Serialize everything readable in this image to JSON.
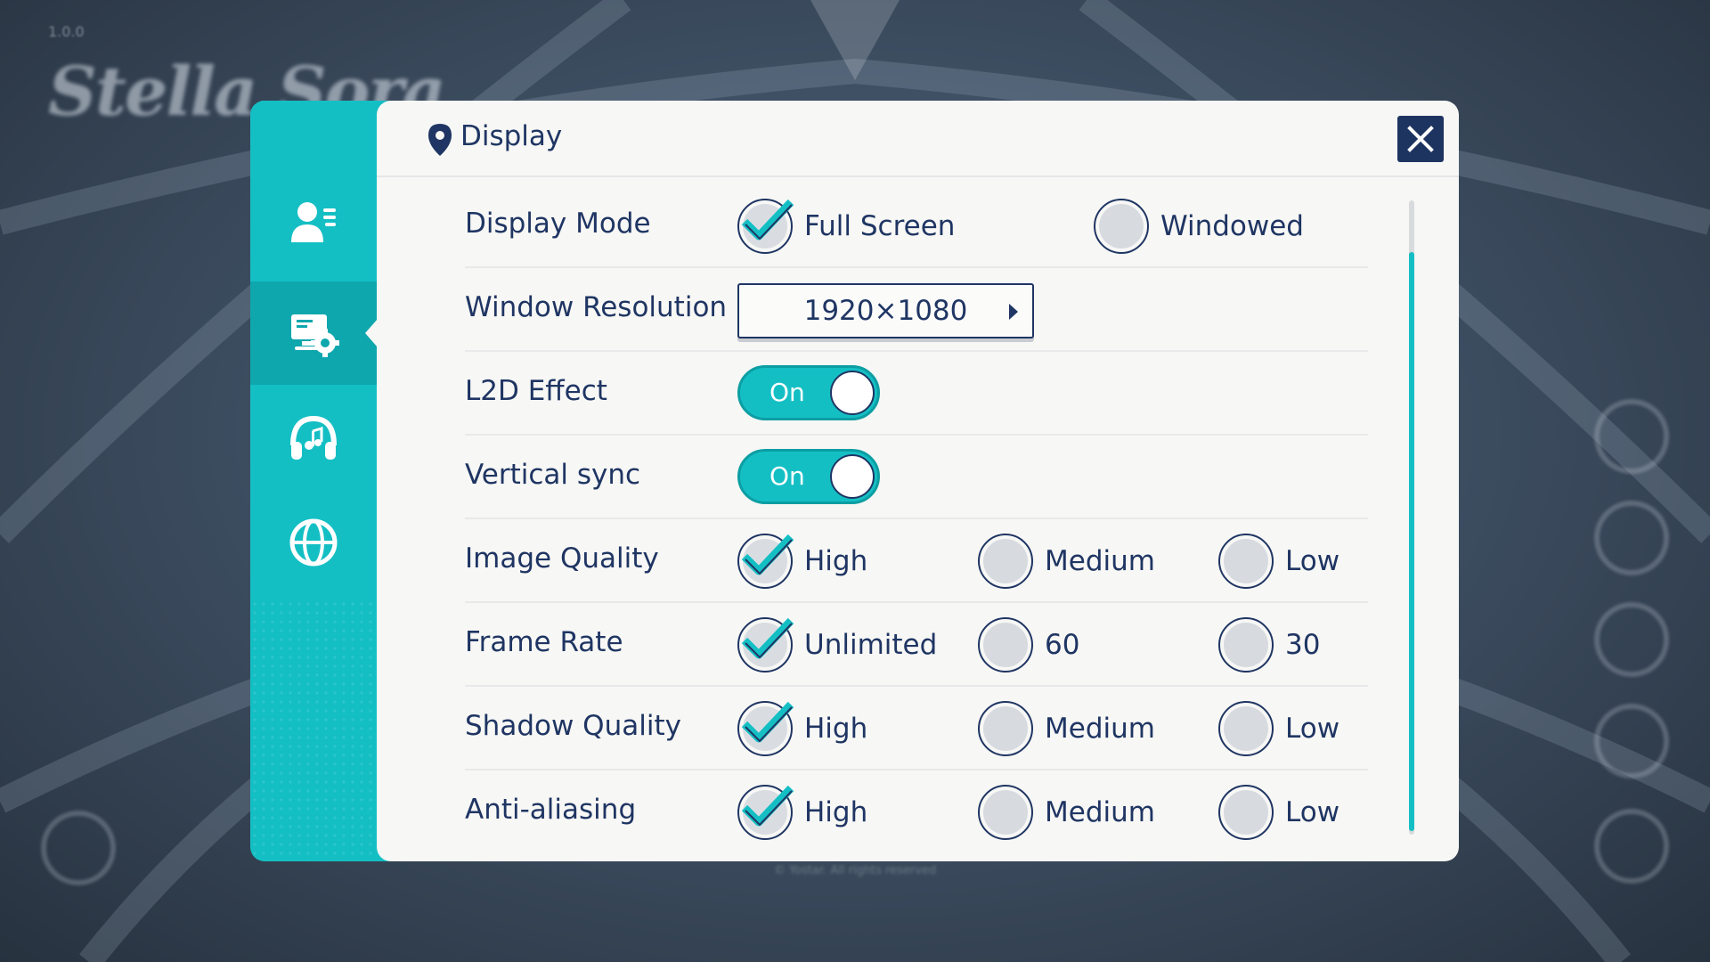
{
  "background": {
    "logo_small": "1.0.0",
    "logo": "Stella Sora",
    "copyright": "© Yostar. All rights reserved"
  },
  "sidebar": {
    "items": [
      {
        "name": "account",
        "icon": "user-list-icon",
        "active": false
      },
      {
        "name": "display",
        "icon": "monitor-gear-icon",
        "active": true
      },
      {
        "name": "audio",
        "icon": "headphones-icon",
        "active": false
      },
      {
        "name": "language",
        "icon": "globe-icon",
        "active": false
      }
    ]
  },
  "header": {
    "icon": "location-pin-icon",
    "title": "Display",
    "close_icon": "close-icon"
  },
  "settings": {
    "display_mode": {
      "label": "Display Mode",
      "options": [
        {
          "label": "Full Screen",
          "checked": true
        },
        {
          "label": "Windowed",
          "checked": false
        }
      ]
    },
    "window_resolution": {
      "label": "Window Resolution",
      "value": "1920×1080"
    },
    "l2d_effect": {
      "label": "L2D Effect",
      "state": "On"
    },
    "vertical_sync": {
      "label": "Vertical sync",
      "state": "On"
    },
    "image_quality": {
      "label": "Image Quality",
      "options": [
        {
          "label": "High",
          "checked": true
        },
        {
          "label": "Medium",
          "checked": false
        },
        {
          "label": "Low",
          "checked": false
        }
      ]
    },
    "frame_rate": {
      "label": "Frame Rate",
      "options": [
        {
          "label": "Unlimited",
          "checked": true
        },
        {
          "label": "60",
          "checked": false
        },
        {
          "label": "30",
          "checked": false
        }
      ]
    },
    "shadow_quality": {
      "label": "Shadow Quality",
      "options": [
        {
          "label": "High",
          "checked": true
        },
        {
          "label": "Medium",
          "checked": false
        },
        {
          "label": "Low",
          "checked": false
        }
      ]
    },
    "anti_aliasing": {
      "label": "Anti-aliasing",
      "options": [
        {
          "label": "High",
          "checked": true
        },
        {
          "label": "Medium",
          "checked": false
        },
        {
          "label": "Low",
          "checked": false
        }
      ]
    }
  },
  "colors": {
    "accent": "#14bfc4",
    "navy": "#1f3563",
    "panel": "#f7f7f5"
  }
}
